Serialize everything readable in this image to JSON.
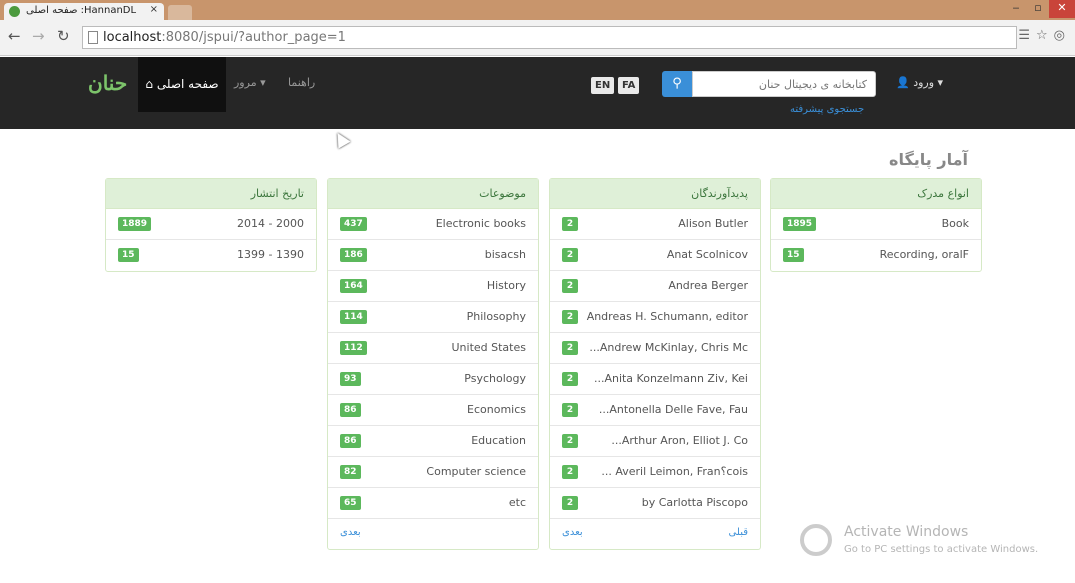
{
  "browser": {
    "tab_title": "صفحه اصلی :HannanDL",
    "tab_close": "×",
    "url_host": "localhost",
    "url_path": ":8080/jspui/?author_page=1"
  },
  "navbar": {
    "logo": "حنان",
    "home": "صفحه اصلی",
    "browse": "مرور ▾",
    "help": "راهنما",
    "lang_en": "EN",
    "lang_fa": "FA",
    "search_placeholder": "کتابخانه ی دیجیتال حنان",
    "advanced_search": "جستجوی پیشرفته",
    "login": "ورود ▾"
  },
  "heading": "آمار پایگاه",
  "panels": {
    "doc_types": {
      "title": "انواع مدرک",
      "rows": [
        {
          "count": "1895",
          "label": "Book"
        },
        {
          "count": "15",
          "label": "Recording, oralF"
        }
      ]
    },
    "authors": {
      "title": "پدیدآورندگان",
      "rows": [
        {
          "count": "2",
          "label": "Alison Butler"
        },
        {
          "count": "2",
          "label": "Anat Scolnicov"
        },
        {
          "count": "2",
          "label": "Andrea Berger"
        },
        {
          "count": "2",
          "label": "Andreas H. Schumann, editor"
        },
        {
          "count": "2",
          "label": "...Andrew McKinlay, Chris Mc"
        },
        {
          "count": "2",
          "label": "...Anita Konzelmann Ziv, Kei"
        },
        {
          "count": "2",
          "label": "...Antonella Delle Fave, Fau"
        },
        {
          "count": "2",
          "label": "...Arthur Aron, Elliot J. Co"
        },
        {
          "count": "2",
          "label": "... Averil Leimon, Fran؟cois"
        },
        {
          "count": "2",
          "label": "by Carlotta Piscopo"
        }
      ],
      "prev": "قبلی",
      "next": "بعدی"
    },
    "subjects": {
      "title": "موضوعات",
      "rows": [
        {
          "count": "437",
          "label": "Electronic books"
        },
        {
          "count": "186",
          "label": "bisacsh"
        },
        {
          "count": "164",
          "label": "History"
        },
        {
          "count": "114",
          "label": "Philosophy"
        },
        {
          "count": "112",
          "label": "United States"
        },
        {
          "count": "93",
          "label": "Psychology"
        },
        {
          "count": "86",
          "label": "Economics"
        },
        {
          "count": "86",
          "label": "Education"
        },
        {
          "count": "82",
          "label": "Computer science"
        },
        {
          "count": "65",
          "label": "etc"
        }
      ],
      "next": "بعدی"
    },
    "dates": {
      "title": "تاریخ انتشار",
      "rows": [
        {
          "count": "1889",
          "label": "2014 - 2000"
        },
        {
          "count": "15",
          "label": "1399 - 1390"
        }
      ]
    }
  },
  "watermark": {
    "line1": "Activate Windows",
    "line2": "Go to PC settings to activate Windows."
  },
  "colors": {
    "navbar_bg": "#262626",
    "panel_heading_bg": "#dff0d8",
    "badge_bg": "#5cb85c",
    "search_button_bg": "#3a8fd8"
  }
}
